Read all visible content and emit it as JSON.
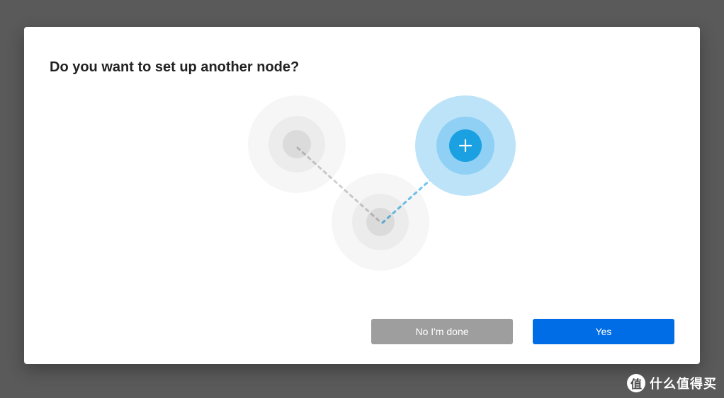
{
  "modal": {
    "title": "Do you want to set up another node?",
    "buttons": {
      "no_label": "No I'm done",
      "yes_label": "Yes"
    }
  },
  "nodes": {
    "add_icon": "plus-icon"
  },
  "watermark": {
    "badge": "值",
    "text": "什么值得买"
  }
}
